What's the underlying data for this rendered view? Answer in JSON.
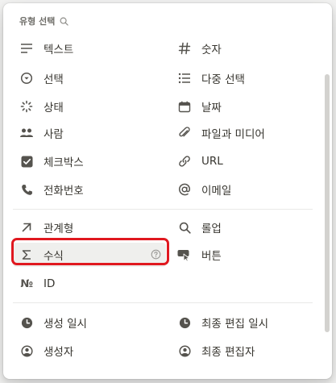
{
  "menu": {
    "header_label": "유형 선택",
    "basic_left": [
      {
        "label": "텍스트",
        "icon": "text-lines-icon"
      },
      {
        "label": "선택",
        "icon": "select-circle-icon"
      },
      {
        "label": "상태",
        "icon": "status-spinner-icon"
      },
      {
        "label": "사람",
        "icon": "people-icon"
      },
      {
        "label": "체크박스",
        "icon": "checkbox-icon"
      },
      {
        "label": "전화번호",
        "icon": "phone-icon"
      }
    ],
    "basic_right": [
      {
        "label": "숫자",
        "icon": "hash-icon"
      },
      {
        "label": "다중 선택",
        "icon": "multi-list-icon"
      },
      {
        "label": "날짜",
        "icon": "calendar-icon"
      },
      {
        "label": "파일과 미디어",
        "icon": "paperclip-icon"
      },
      {
        "label": "URL",
        "icon": "link-icon"
      },
      {
        "label": "이메일",
        "icon": "at-icon"
      }
    ],
    "advanced_left": [
      {
        "label": "관계형",
        "icon": "arrow-up-right-icon"
      },
      {
        "label": "수식",
        "icon": "sigma-icon"
      },
      {
        "label": "ID",
        "icon": "numero-icon",
        "glyph": "№"
      }
    ],
    "advanced_right": [
      {
        "label": "롤업",
        "icon": "magnifier-icon"
      },
      {
        "label": "버튼",
        "icon": "cursor-click-icon"
      }
    ],
    "meta_left": [
      {
        "label": "생성 일시",
        "icon": "clock-icon"
      },
      {
        "label": "생성자",
        "icon": "user-circle-icon"
      }
    ],
    "meta_right": [
      {
        "label": "최종 편집 일시",
        "icon": "clock-icon"
      },
      {
        "label": "최종 편집자",
        "icon": "user-circle-icon"
      }
    ],
    "highlighted_item": "수식"
  },
  "colors": {
    "text": "#37352f",
    "icon": "#55534e",
    "header": "#6f6e69",
    "highlight_outline": "#e0181f",
    "hover_bg": "#efefed"
  }
}
